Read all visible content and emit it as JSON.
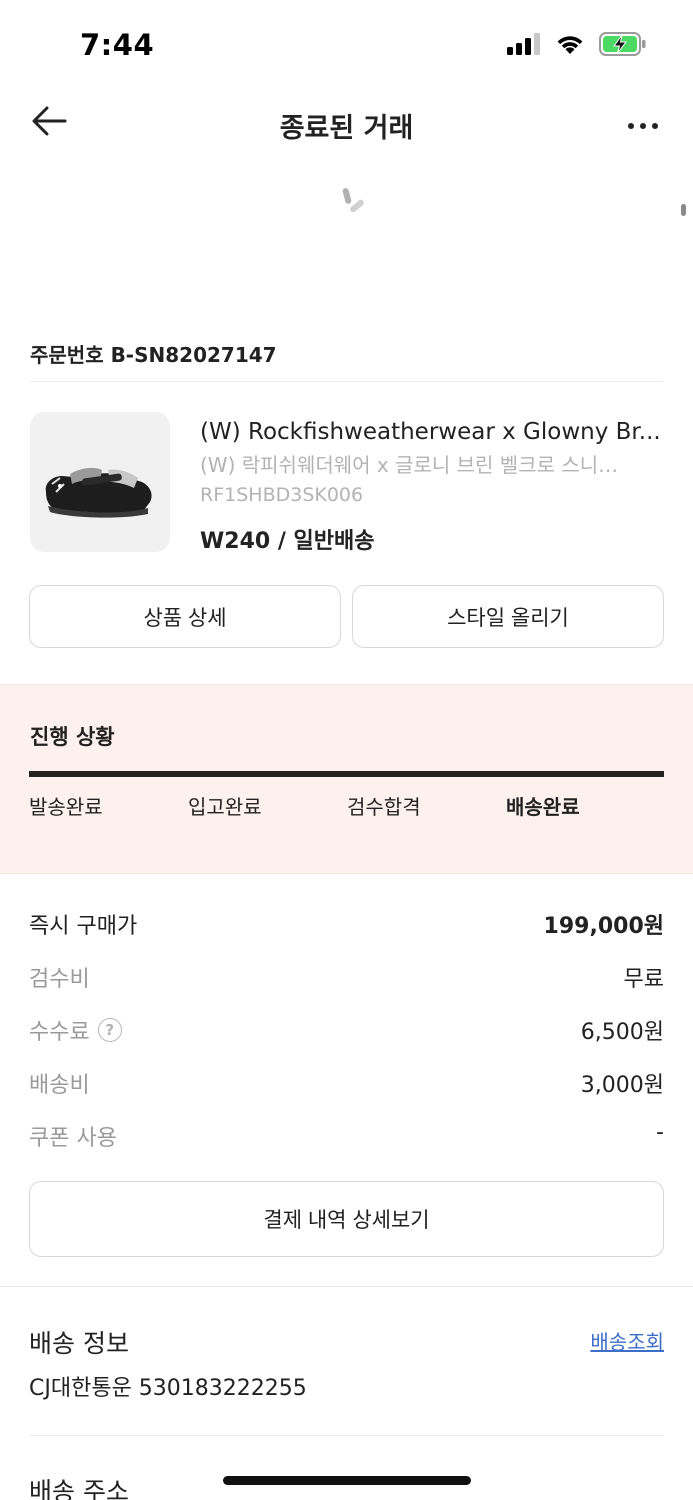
{
  "status_bar": {
    "time": "7:44",
    "icons": [
      "signal-icon",
      "wifi-icon",
      "battery-charging-icon"
    ],
    "battery_color": "#4cd964"
  },
  "nav": {
    "title": "종료된 거래",
    "back_icon": "arrow-left-icon",
    "more_icon": "more-horizontal-icon"
  },
  "order": {
    "number_label": "주문번호 B-SN82027147"
  },
  "product": {
    "name_en": "(W) Rockfishweatherwear x Glowny Br...",
    "name_ko": "(W) 락피쉬웨더웨어 x 글로니 브린 벨크로 스니…",
    "code": "RF1SHBD3SK006",
    "option": "W240 / 일반배송"
  },
  "buttons": {
    "product_detail": "상품 상세",
    "upload_style": "스타일 올리기",
    "payment_detail": "결제 내역 상세보기"
  },
  "progress": {
    "title": "진행 상황",
    "fill_fraction": 1.0,
    "steps": [
      {
        "label": "발송완료",
        "active": false
      },
      {
        "label": "입고완료",
        "active": false
      },
      {
        "label": "검수합격",
        "active": false
      },
      {
        "label": "배송완료",
        "active": true
      }
    ],
    "background_color": "#fdf1ef"
  },
  "prices": [
    {
      "label": "즉시 구매가",
      "value": "199,000원",
      "main": true,
      "help": false
    },
    {
      "label": "검수비",
      "value": "무료",
      "main": false,
      "help": false
    },
    {
      "label": "수수료",
      "value": "6,500원",
      "main": false,
      "help": true
    },
    {
      "label": "배송비",
      "value": "3,000원",
      "main": false,
      "help": false
    },
    {
      "label": "쿠폰 사용",
      "value": "-",
      "main": false,
      "help": false
    }
  ],
  "shipping": {
    "title": "배송 정보",
    "track_link": "배송조회",
    "tracking": "CJ대한통운 530183222255",
    "link_color": "#3d6fc8"
  },
  "address": {
    "title": "배송 주소"
  }
}
